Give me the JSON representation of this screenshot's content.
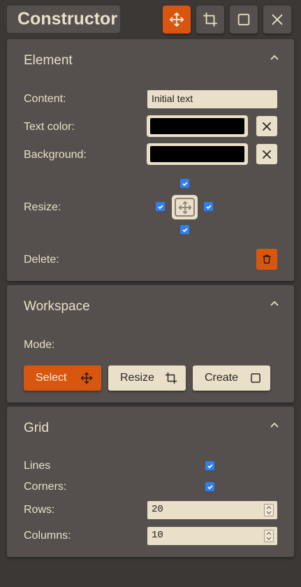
{
  "app": {
    "title": "Constructor",
    "toolbar": [
      {
        "name": "move-icon",
        "active": true
      },
      {
        "name": "crop-icon",
        "active": false
      },
      {
        "name": "square-icon",
        "active": false
      },
      {
        "name": "close-icon",
        "active": false
      }
    ]
  },
  "element_panel": {
    "title": "Element",
    "content_label": "Content:",
    "content_value": "Initial text",
    "text_color_label": "Text color:",
    "text_color_value": "#000000",
    "background_label": "Background:",
    "background_value": "#000000",
    "resize_label": "Resize:",
    "resize_top": true,
    "resize_left": true,
    "resize_right": true,
    "resize_bottom": true,
    "delete_label": "Delete:"
  },
  "workspace_panel": {
    "title": "Workspace",
    "mode_label": "Mode:",
    "modes": [
      {
        "label": "Select",
        "icon": "move-icon",
        "active": true
      },
      {
        "label": "Resize",
        "icon": "crop-icon",
        "active": false
      },
      {
        "label": "Create",
        "icon": "square-icon",
        "active": false
      }
    ]
  },
  "grid_panel": {
    "title": "Grid",
    "lines_label": "Lines",
    "lines_checked": true,
    "corners_label": "Corners:",
    "corners_checked": true,
    "rows_label": "Rows:",
    "rows_value": "20",
    "columns_label": "Columns:",
    "columns_value": "10"
  },
  "colors": {
    "accent": "#d9560f",
    "panel": "#55504d",
    "background": "#3b3836",
    "text": "#eadfc9",
    "checkbox": "#2f7ff1"
  }
}
